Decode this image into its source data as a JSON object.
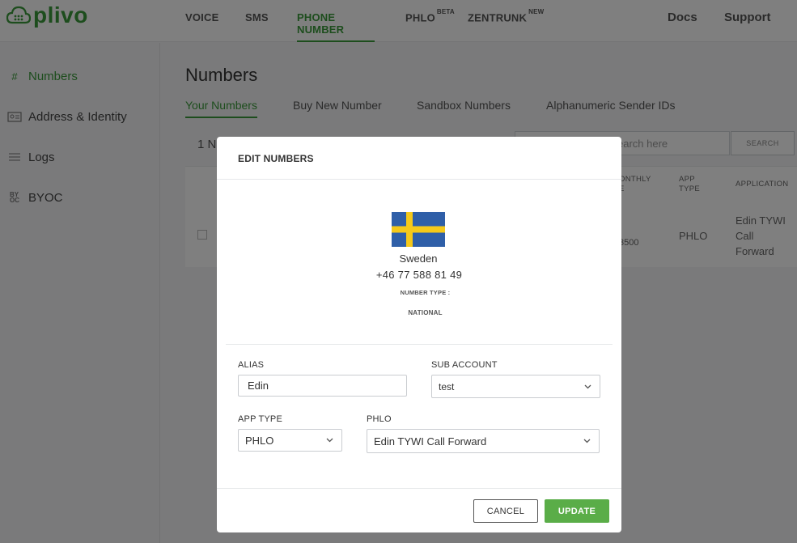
{
  "brand": {
    "name": "plivo",
    "color": "#3a9b3a"
  },
  "topnav": {
    "items": [
      {
        "label": "VOICE",
        "sup": ""
      },
      {
        "label": "SMS",
        "sup": ""
      },
      {
        "label": "PHONE NUMBER",
        "sup": "",
        "active": true
      },
      {
        "label": "PHLO",
        "sup": "BETA"
      },
      {
        "label": "ZENTRUNK",
        "sup": "NEW"
      }
    ],
    "right": [
      "Docs",
      "Support"
    ]
  },
  "sidebar": {
    "items": [
      {
        "label": "Numbers",
        "icon": "hash-icon",
        "active": true
      },
      {
        "label": "Address & Identity",
        "icon": "id-card-icon"
      },
      {
        "label": "Logs",
        "icon": "list-icon"
      },
      {
        "label": "BYOC",
        "icon": "byoc-icon"
      }
    ]
  },
  "page": {
    "title": "Numbers",
    "tabs": [
      "Your Numbers",
      "Buy New Number",
      "Sandbox Numbers",
      "Alphanumeric Sender IDs"
    ],
    "active_tab": "Your Numbers",
    "count_label": "1 N",
    "search": {
      "placeholder": "earch here",
      "button": "SEARCH"
    },
    "table": {
      "headers": {
        "monthly": "ONTHLY\nE",
        "app_type": "APP\nTYPE",
        "application": "APPLICATION"
      },
      "row": {
        "monthly": "3500",
        "app_type": "PHLO",
        "application": "Edin TYWI\nCall\nForward"
      }
    }
  },
  "modal": {
    "title": "EDIT NUMBERS",
    "country": "Sweden",
    "flag": "sweden-flag-icon",
    "phone": "+46 77 588 81 49",
    "number_type_label": "NUMBER TYPE :",
    "number_type_value": "NATIONAL",
    "alias": {
      "label": "ALIAS",
      "value": "Edin"
    },
    "sub_account": {
      "label": "SUB ACCOUNT",
      "value": "test"
    },
    "app_type": {
      "label": "APP TYPE",
      "value": "PHLO"
    },
    "phlo": {
      "label": "PHLO",
      "value": "Edin TYWI Call Forward"
    },
    "cancel_label": "CANCEL",
    "update_label": "UPDATE",
    "colors": {
      "update": "#5aad48",
      "flag_blue": "#2f5fa8",
      "flag_yellow": "#f5c91a"
    }
  }
}
